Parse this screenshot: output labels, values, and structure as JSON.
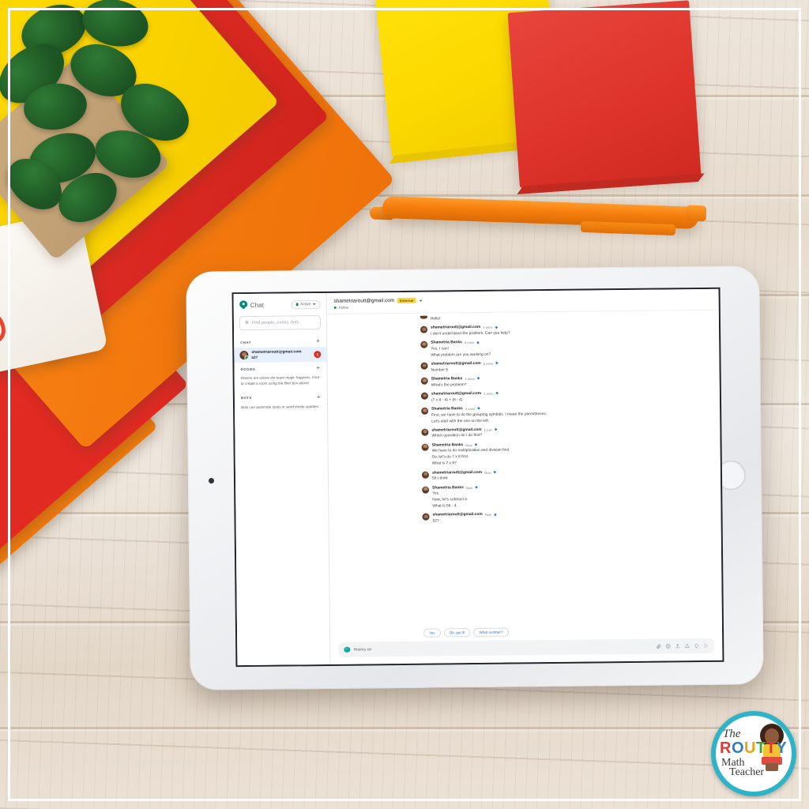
{
  "sidebar": {
    "brand": "Chat",
    "brand_icon": "chat-bubble-icon",
    "status_label": "Active",
    "search_placeholder": "Find people, rooms, bots",
    "search_icon": "filter-search-icon",
    "sections": {
      "chat": {
        "label": "CHAT",
        "add_icon": "plus-icon"
      },
      "rooms": {
        "label": "ROOMS",
        "add_icon": "plus-icon",
        "note": "Rooms are where the team magic happens. Find or create a room using the filter box above."
      },
      "bots": {
        "label": "BOTS",
        "add_icon": "plus-icon",
        "note": "Bots can automate tasks or send timely updates."
      }
    },
    "chat_item": {
      "name": "shametriaroutt@gmail.com",
      "preview": "52?",
      "unread": "1"
    }
  },
  "header": {
    "title": "shametriaroutt@gmail.com",
    "badge": "External",
    "status": "Active",
    "more_icon": "chevron-down-icon"
  },
  "thread": {
    "top_partial_line": "Hello!",
    "messages": [
      {
        "name": "shametriaroutt@gmail.com",
        "time": "6 mins",
        "lines": [
          "I don't understand the problem. Can you help?"
        ]
      },
      {
        "name": "Shametria Banks",
        "time": "6 mins",
        "lines": [
          "Yes, I can!",
          "What problem are you working on?"
        ]
      },
      {
        "name": "shametriaroutt@gmail.com",
        "time": "5 mins",
        "lines": [
          "Number 5"
        ]
      },
      {
        "name": "Shametria Banks",
        "time": "4 mins",
        "lines": [
          "What's the problem?"
        ]
      },
      {
        "name": "shametriaroutt@gmail.com",
        "time": "2 mins",
        "lines": [
          "(7 x 8 - 4) + (6 - 4)"
        ]
      },
      {
        "name": "Shametria Banks",
        "time": "2 mins",
        "lines": [
          "First, we have to do the grouping symbols. I mean the parentheses.",
          "Let's start with the one on the left."
        ]
      },
      {
        "name": "shametriaroutt@gmail.com",
        "time": "1 min",
        "lines": [
          "Which operation do I do first?"
        ]
      },
      {
        "name": "Shametria Banks",
        "time": "Now",
        "lines": [
          "We have to do multiplication and division first.",
          "So, let's do 7 x 8 first.",
          "What is 7 x 8?"
        ]
      },
      {
        "name": "shametriaroutt@gmail.com",
        "time": "Now",
        "lines": [
          "56 I think"
        ]
      },
      {
        "name": "Shametria Banks",
        "time": "Now",
        "lines": [
          "Yes.",
          "Now, let's subtract 4.",
          "What is 56 - 4."
        ]
      },
      {
        "name": "shametriaroutt@gmail.com",
        "time": "Now",
        "lines": [
          "52?"
        ]
      }
    ]
  },
  "quick_replies": [
    "Yes",
    "Oh, got it!",
    "What number?"
  ],
  "compose": {
    "placeholder": "History on",
    "icons": [
      "bot-avatar-icon",
      "attachment-icon",
      "emoji-icon",
      "upload-icon",
      "drive-icon",
      "video-meet-icon",
      "send-icon"
    ]
  },
  "watermark": {
    "line1": "The",
    "line2": "ROUTTY",
    "line3": "Math",
    "line4": "Teacher"
  },
  "colors": {
    "accent_blue": "#1a73e8",
    "badge_yellow": "#fdd633",
    "unread_red": "#d93025",
    "active_green": "#1e8e3e",
    "brand_teal": "#00897b"
  }
}
